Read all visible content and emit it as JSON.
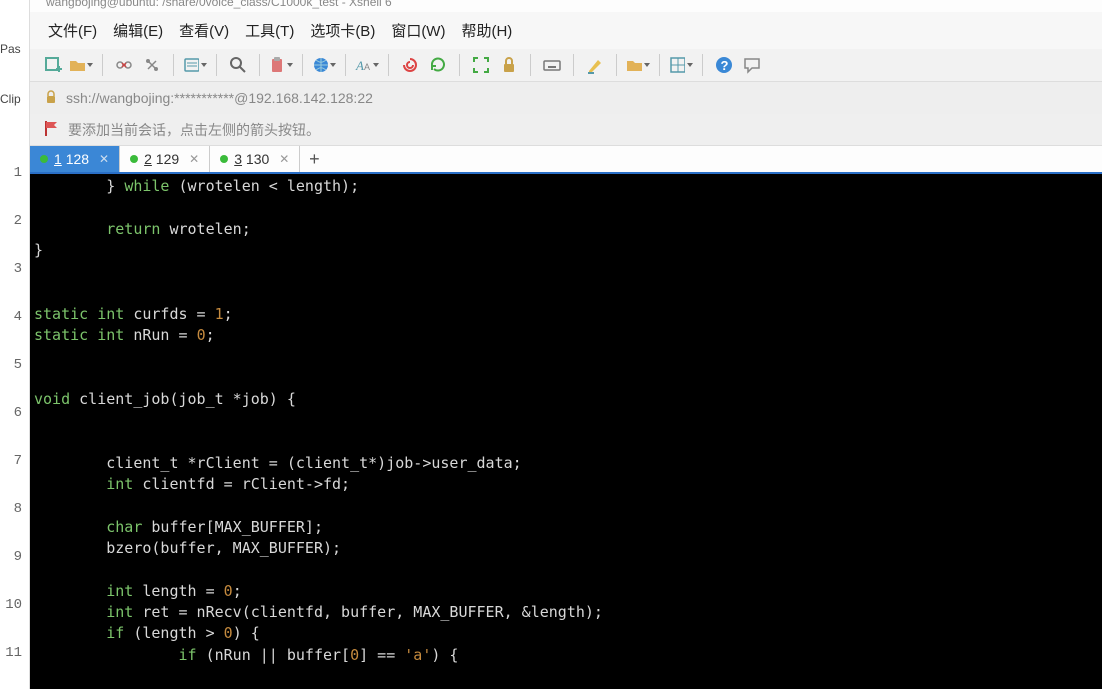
{
  "title_fragment": "wangbojing@ubuntu: /share/0voice_class/C1000k_test - Xshell 6",
  "left_panel": {
    "label_a": "Pas",
    "label_b": "Clip",
    "numbers": [
      "1",
      "2",
      "3",
      "4",
      "5",
      "6",
      "7",
      "8",
      "9",
      "10",
      "11"
    ]
  },
  "menubar": {
    "file": "文件(F)",
    "edit": "编辑(E)",
    "view": "查看(V)",
    "tools": "工具(T)",
    "tabs": "选项卡(B)",
    "window": "窗口(W)",
    "help": "帮助(H)"
  },
  "address_bar": "ssh://wangbojing:***********@192.168.142.128:22",
  "tip_bar": "要添加当前会话，点击左侧的箭头按钮。",
  "tabs": [
    {
      "num": "1",
      "label": "128",
      "active": true
    },
    {
      "num": "2",
      "label": "129",
      "active": false
    },
    {
      "num": "3",
      "label": "130",
      "active": false
    }
  ],
  "code": {
    "l0a": "        } ",
    "l0b": "while",
    "l0c": " (wrotelen < length);",
    "l1": "",
    "l2a": "        ",
    "l2b": "return",
    "l2c": " wrotelen;",
    "l3": "}",
    "l4": "",
    "l5": "",
    "l6a": "static int",
    "l6a2": " curfds = ",
    "l6n": "1",
    "l6e": ";",
    "l7a": "static int",
    "l7a2": " nRun = ",
    "l7n": "0",
    "l7e": ";",
    "l8": "",
    "l9": "",
    "l10a": "void",
    "l10b": " client_job(job_t *job) {",
    "l11": "",
    "l12": "",
    "l13": "        client_t *rClient = (client_t*)job->user_data;",
    "l14a": "        ",
    "l14b": "int",
    "l14c": " clientfd = rClient->fd;",
    "l15": "",
    "l16a": "        ",
    "l16b": "char",
    "l16c": " buffer[MAX_BUFFER];",
    "l17": "        bzero(buffer, MAX_BUFFER);",
    "l18": "",
    "l19a": "        ",
    "l19b": "int",
    "l19c": " length = ",
    "l19n": "0",
    "l19e": ";",
    "l20a": "        ",
    "l20b": "int",
    "l20c": " ret = nRecv(clientfd, buffer, MAX_BUFFER, &length);",
    "l21a": "        ",
    "l21b": "if",
    "l21c": " (length > ",
    "l21n": "0",
    "l21e": ") {",
    "l22a": "                ",
    "l22b": "if",
    "l22c": " (nRun || buffer[",
    "l22n": "0",
    "l22d": "] == ",
    "l22ch": "'a'",
    "l22e": ") {"
  }
}
